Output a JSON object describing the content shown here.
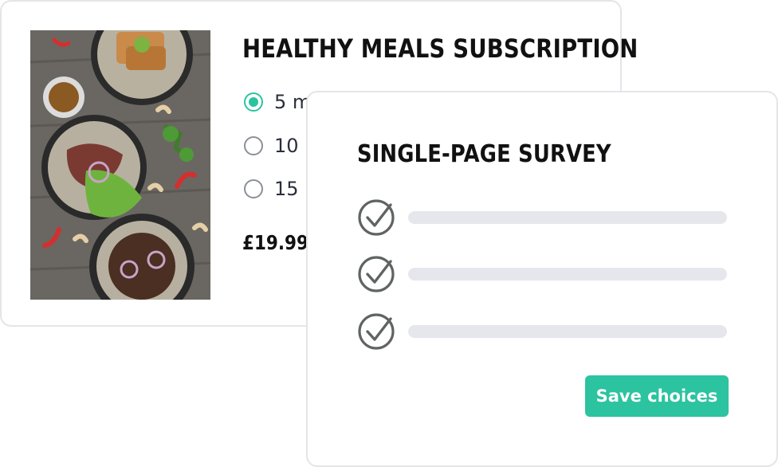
{
  "product": {
    "title": "HEALTHY MEALS SUBSCRIPTION",
    "options": [
      {
        "label": "5 m",
        "selected": true
      },
      {
        "label": "10",
        "selected": false
      },
      {
        "label": "15",
        "selected": false
      }
    ],
    "price": "£19.99"
  },
  "survey": {
    "title": "SINGLE-PAGE SURVEY",
    "rows": [
      {
        "icon": "check-circle-icon",
        "checked": true
      },
      {
        "icon": "check-circle-icon",
        "checked": true
      },
      {
        "icon": "check-circle-icon",
        "checked": true
      }
    ],
    "save_label": "Save choices"
  },
  "colors": {
    "accent": "#2cc3a0",
    "card_border": "#e4e5e8",
    "placeholder_bar": "#e6e7ec",
    "check_icon": "#5f6462"
  }
}
